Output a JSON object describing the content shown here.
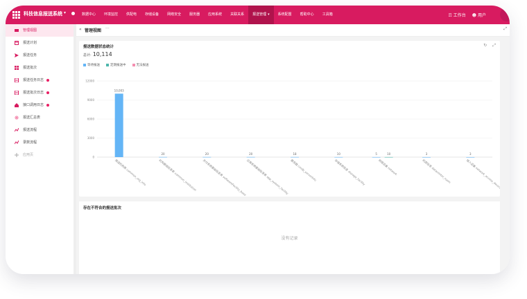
{
  "header": {
    "app_title": "科技信息报送系统",
    "title_caret": "▾",
    "nav": [
      {
        "label": "数据中心",
        "active": false
      },
      {
        "label": "环境监控",
        "active": false
      },
      {
        "label": "供配电",
        "active": false
      },
      {
        "label": "存储设备",
        "active": false
      },
      {
        "label": "网络安全",
        "active": false
      },
      {
        "label": "服务器",
        "active": false
      },
      {
        "label": "应用系统",
        "active": false
      },
      {
        "label": "关联关系",
        "active": false
      },
      {
        "label": "报送管理",
        "active": true,
        "caret": "▾"
      },
      {
        "label": "系统配置",
        "active": false
      },
      {
        "label": "帮助中心",
        "active": false
      },
      {
        "label": "工具箱",
        "active": false
      }
    ],
    "workbench_label": "工作台",
    "user_label": "用户"
  },
  "sidebar": {
    "items": [
      {
        "label": "管理视图",
        "icon": "monitor-icon",
        "active": true,
        "badge": false
      },
      {
        "label": "报送计划",
        "icon": "calendar-icon",
        "active": false,
        "badge": false
      },
      {
        "label": "报送任务",
        "icon": "send-icon",
        "active": false,
        "badge": false
      },
      {
        "label": "报送批次",
        "icon": "grid-icon",
        "active": false,
        "badge": false
      },
      {
        "label": "报送任务日志",
        "icon": "document-icon",
        "active": false,
        "badge": true
      },
      {
        "label": "报送批次日志",
        "icon": "document-icon",
        "active": false,
        "badge": true
      },
      {
        "label": "接口调用日志",
        "icon": "home-icon",
        "active": false,
        "badge": true
      },
      {
        "label": "报送汇总表",
        "icon": "asterisk-icon",
        "active": false,
        "badge": false
      },
      {
        "label": "报送流程",
        "icon": "flow-icon",
        "active": false,
        "badge": false
      },
      {
        "label": "录数流程",
        "icon": "flow-icon",
        "active": false,
        "badge": false
      },
      {
        "label": "应用页",
        "icon": "plus-icon",
        "active": false,
        "badge": false,
        "muted": true
      }
    ]
  },
  "tabbar": {
    "collapse": "«",
    "title": "管理视图",
    "more": "···",
    "expand": "⤢"
  },
  "card1": {
    "title": "报送数据状态统计",
    "total_label": "总计:",
    "total_value": "10,114",
    "refresh": "↻",
    "fullscreen": "⤢"
  },
  "chart_data": {
    "type": "bar",
    "title": "报送数据状态统计",
    "legend": [
      {
        "name": "等待报送",
        "color": "#64b5f6"
      },
      {
        "name": "定期报送中",
        "color": "#4db6ac"
      },
      {
        "name": "无法报送",
        "color": "#f48fb1"
      }
    ],
    "categories": [
      "报送机构表 common_org_info",
      "机构基础信息表 common_institution",
      "交付系统基础信息表 softwareFacility_base",
      "应用系统基础信息表 app_system_facility",
      "服务器 cmdb_serverInfo",
      "存储系统信息 storage_facility",
      "网络设备 network",
      "机房信息 datacenter_room",
      "接入设备 network_access_device"
    ],
    "series": [
      {
        "name": "等待报送",
        "values": [
          10003,
          20,
          20,
          20,
          18,
          10,
          5,
          3,
          3
        ]
      },
      {
        "name": "定期报送中",
        "values": [
          0,
          0,
          0,
          0,
          0,
          0,
          10,
          0,
          0
        ]
      }
    ],
    "data_labels": [
      "10,003",
      "20",
      "20",
      "20",
      "18",
      "10",
      "5",
      "10",
      "3",
      "3"
    ],
    "yticks": [
      "0",
      "3000",
      "6000",
      "9000",
      "12000"
    ],
    "ylim": [
      0,
      12000
    ],
    "grid": true,
    "legend_position": "top-left"
  },
  "card2": {
    "title": "存在不符合的报送批次",
    "empty_text": "没有记录"
  }
}
